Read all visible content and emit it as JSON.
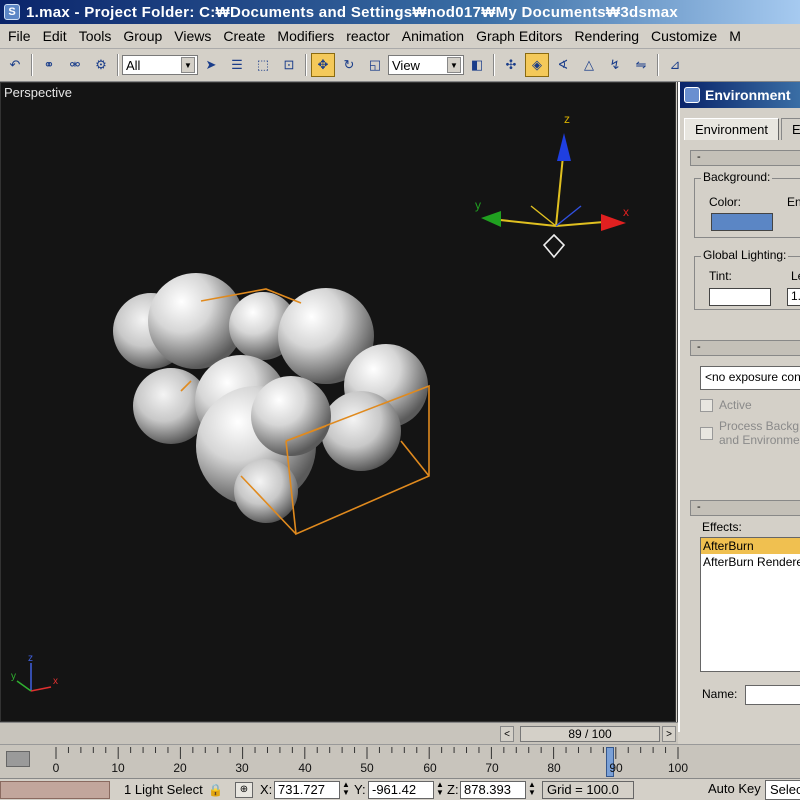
{
  "titlebar": {
    "app_icon": "3ds-max-icon",
    "title": "1.max      - Project Folder: C:₩Documents and Settings₩nod017₩My Documents₩3dsmax"
  },
  "menu": {
    "items": [
      "File",
      "Edit",
      "Tools",
      "Group",
      "Views",
      "Create",
      "Modifiers",
      "reactor",
      "Animation",
      "Graph Editors",
      "Rendering",
      "Customize",
      "M"
    ]
  },
  "toolbar": {
    "selection_filter": "All",
    "reference_coord": "View"
  },
  "viewport": {
    "label": "Perspective",
    "gizmo_axes": {
      "x": "x",
      "y": "y",
      "z": "z"
    },
    "corner_axes": {
      "x": "x",
      "y": "y",
      "z": "z"
    }
  },
  "environment_dialog": {
    "title": "Environment",
    "tabs": [
      "Environment",
      "E"
    ],
    "rollout_collapse": "-",
    "background_group": "Background:",
    "color_label": "Color:",
    "env_map_label": "En",
    "background_color": "#5b86c5",
    "global_lighting_group": "Global Lighting:",
    "tint_label": "Tint:",
    "level_label": "Le",
    "level_value": "1.",
    "tint_color": "#ffffff",
    "exposure_dropdown": "<no exposure control>",
    "active_label": "Active",
    "process_bg_label_1": "Process Backg",
    "process_bg_label_2": "and Environme",
    "effects_label": "Effects:",
    "effects_list": [
      "AfterBurn",
      "AfterBurn Renderer"
    ],
    "name_label": "Name:"
  },
  "timeline": {
    "frame_display": "89 / 100",
    "prev_arrow": "<",
    "next_arrow": ">",
    "ticks": [
      "0",
      "10",
      "20",
      "30",
      "40",
      "50",
      "60",
      "70",
      "80",
      "90",
      "100"
    ]
  },
  "statusbar": {
    "selection_count": "1 Light Select",
    "lock_icon": "lock-icon",
    "x_label": "X:",
    "x_value": "731.727",
    "y_label": "Y:",
    "y_value": "-961.42",
    "z_label": "Z:",
    "z_value": "878.393",
    "grid": "Grid = 100.0",
    "auto_key": "Auto Key",
    "selected_box": "Selec"
  }
}
